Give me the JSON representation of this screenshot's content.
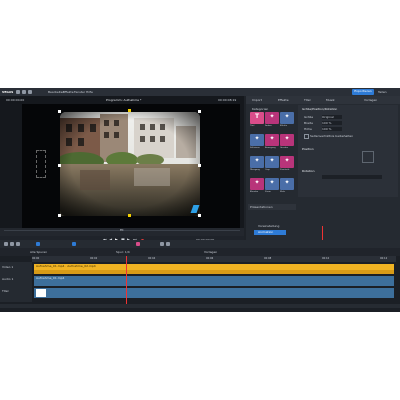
{
  "app": {
    "name": "VEGAS",
    "menu": [
      "Bearbeiten",
      "Effekte",
      "Fenster",
      "Hilfe"
    ],
    "export_button": "Exportieren",
    "share_button": "Teilen"
  },
  "preview": {
    "timecode_left": "00:00:00.00",
    "title": "Programm: Aufnahme *",
    "timecode_right": "00:00:08:19",
    "zoom": "Fit",
    "tc_display": "00:00:00:00"
  },
  "right_panel": {
    "tabs": [
      "Import",
      "Effekte",
      "Titel",
      "Musik",
      "Vorlagen"
    ],
    "category_header": "Kategorien",
    "tiles": [
      {
        "label": "Titel",
        "color": "#d94d8a",
        "icon": "T"
      },
      {
        "label": "Farben",
        "color": "#b8347a",
        "icon": "color"
      },
      {
        "label": "Effekte",
        "color": "#4a6ea8",
        "icon": "fx"
      },
      {
        "label": "Stilisieren",
        "color": "#4a6ea8",
        "icon": "brush"
      },
      {
        "label": "Bewegung",
        "color": "#b8347a",
        "icon": "move"
      },
      {
        "label": "Geschw.",
        "color": "#b8347a",
        "icon": "speed"
      },
      {
        "label": "Übergang",
        "color": "#4a6ea8",
        "icon": "transition"
      },
      {
        "label": "Crop",
        "color": "#4a6ea8",
        "icon": "crop"
      },
      {
        "label": "Zuschnitt",
        "color": "#b8347a",
        "icon": "cut"
      },
      {
        "label": "Blenden",
        "color": "#b8347a",
        "icon": "blend"
      },
      {
        "label": "Zoom",
        "color": "#4a6ea8",
        "icon": "zoom"
      },
      {
        "label": "Mehr",
        "color": "#4a6ea8",
        "icon": "more"
      }
    ],
    "settings_title": "Größe/Position/Rotation",
    "settings_rows": [
      {
        "label": "Größe",
        "value": "Original"
      },
      {
        "label": "Breite",
        "value": "100 %"
      },
      {
        "label": "Höhe",
        "value": "100 %"
      }
    ],
    "checkbox_label": "Seitenverhältnis beibehalten",
    "sub_title_1": "Position",
    "sub_title_2": "Rotation",
    "presets_header": "Präsentationen",
    "preset_items": [
      "Voreinstellung",
      "Animation"
    ]
  },
  "timeline": {
    "toolbar_label": "Alle Spuren",
    "tab_mid": "Spur: 1/4",
    "tab_right": "Vorlagen",
    "tracks": [
      {
        "name": "Video 1",
        "clip_label": "Aufnahme_01.mp4 · Aufnahme_02.mp4",
        "type": "video",
        "color": "#f0b323"
      },
      {
        "name": "Audio 1",
        "clip_label": "Aufnahme_01.mp4",
        "type": "audio",
        "color": "#3d6f9b"
      },
      {
        "name": "Titel",
        "clip_label": "",
        "type": "title",
        "color": "#3d6f9b"
      }
    ],
    "ruler_marks": [
      "00:00",
      "00:02",
      "00:04",
      "00:06",
      "00:08",
      "00:10",
      "00:12"
    ]
  }
}
